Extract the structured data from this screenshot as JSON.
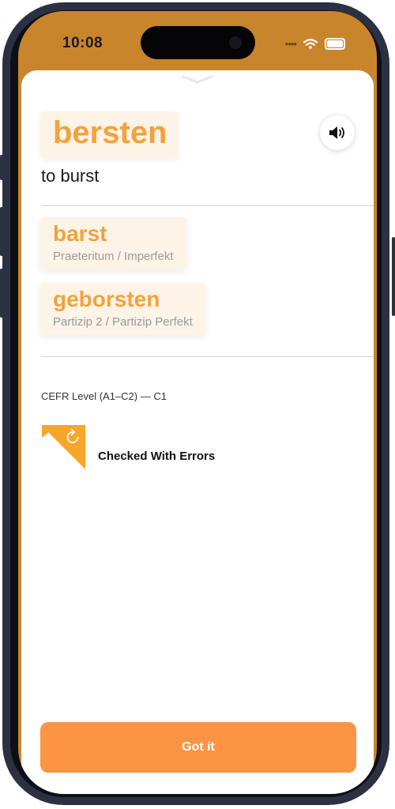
{
  "status_bar": {
    "time": "10:08"
  },
  "word": {
    "headword": "bersten",
    "translation": "to burst"
  },
  "forms": [
    {
      "word": "barst",
      "label": "Praeteritum / Imperfekt"
    },
    {
      "word": "geborsten",
      "label": "Partizip 2 / Partizip Perfekt"
    }
  ],
  "cefr": {
    "text": "CEFR Level (A1–C2) —  C1"
  },
  "check_status": {
    "text": "Checked With Errors",
    "icon": "refresh-icon"
  },
  "action": {
    "label": "Got it"
  },
  "colors": {
    "accent": "#f3a23d",
    "button": "#fd9443",
    "header": "#c9852b",
    "word_box_bg": "#fdf3e7"
  }
}
